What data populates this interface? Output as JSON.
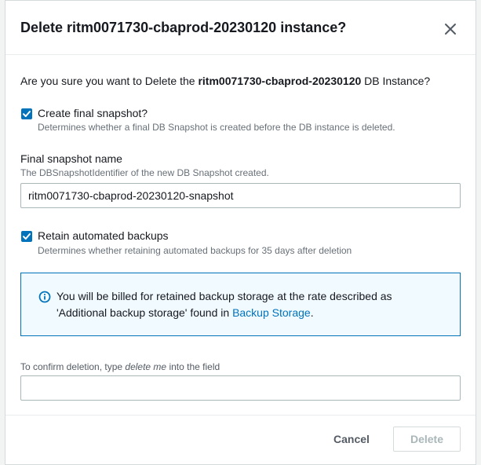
{
  "modal": {
    "title": "Delete ritm0071730-cbaprod-20230120 instance?",
    "close_icon": "close-icon"
  },
  "question": {
    "prefix": "Are you sure you want to Delete the ",
    "instance": "ritm0071730-cbaprod-20230120",
    "suffix": " DB Instance?"
  },
  "final_snapshot_checkbox": {
    "checked": true,
    "label": "Create final snapshot?",
    "description": "Determines whether a final DB Snapshot is created before the DB instance is deleted."
  },
  "snapshot_name": {
    "label": "Final snapshot name",
    "description": "The DBSnapshotIdentifier of the new DB Snapshot created.",
    "value": "ritm0071730-cbaprod-20230120-snapshot"
  },
  "retain_backups_checkbox": {
    "checked": true,
    "label": "Retain automated backups",
    "description": "Determines whether retaining automated backups for 35 days after deletion"
  },
  "info_alert": {
    "icon": "info-icon",
    "line1": "You will be billed for retained backup storage at the rate described as",
    "line2_prefix": "'Additional backup storage' found in ",
    "link_text": "Backup Storage",
    "line2_suffix": "."
  },
  "confirm": {
    "label_prefix": "To confirm deletion, type ",
    "keyword": "delete me",
    "label_suffix": " into the field",
    "value": ""
  },
  "footer": {
    "cancel_label": "Cancel",
    "delete_label": "Delete"
  },
  "colors": {
    "accent": "#0073bb",
    "info_bg": "#f1faff",
    "disabled_text": "#aab7b8"
  }
}
